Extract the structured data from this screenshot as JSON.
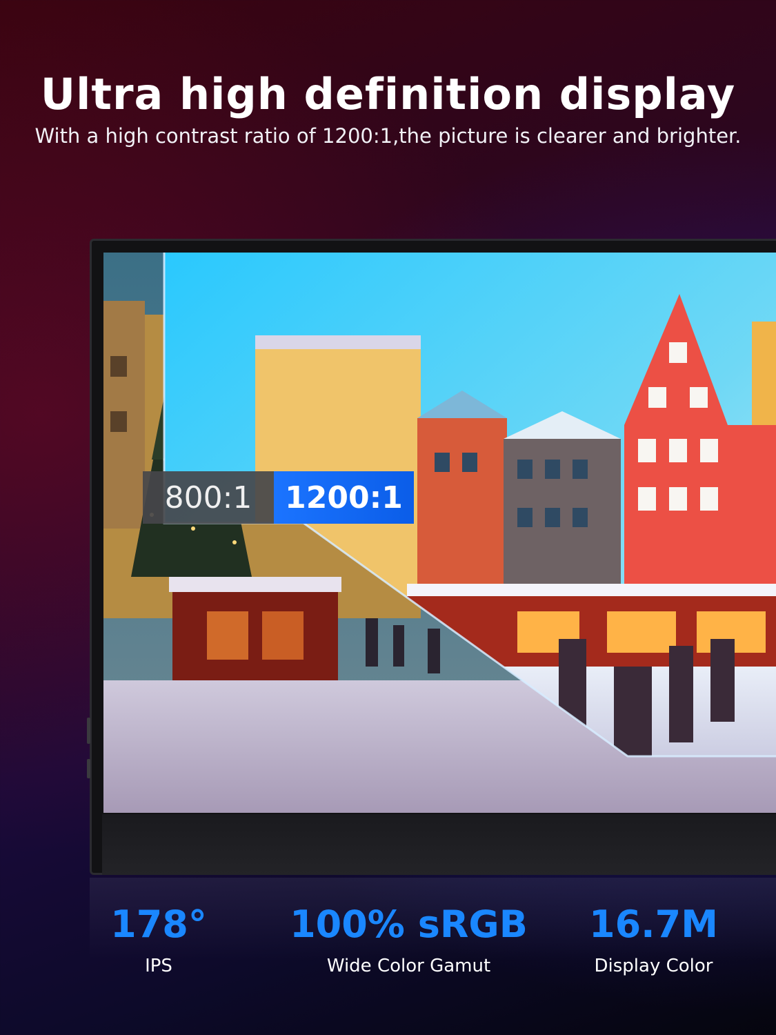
{
  "header": {
    "title": "Ultra high definition display",
    "subtitle": "With a high contrast ratio of 1200:1,the picture is clearer and brighter."
  },
  "comparison": {
    "low_contrast": "800:1",
    "high_contrast": "1200:1"
  },
  "specs": [
    {
      "value": "178°",
      "label": "IPS"
    },
    {
      "value": "100% sRGB",
      "label": "Wide Color Gamut"
    },
    {
      "value": "16.7M",
      "label": "Display Color"
    }
  ],
  "colors": {
    "accent_blue": "#1a87ff",
    "badge_blue": "#1b74ff",
    "badge_gray": "#46464b"
  }
}
